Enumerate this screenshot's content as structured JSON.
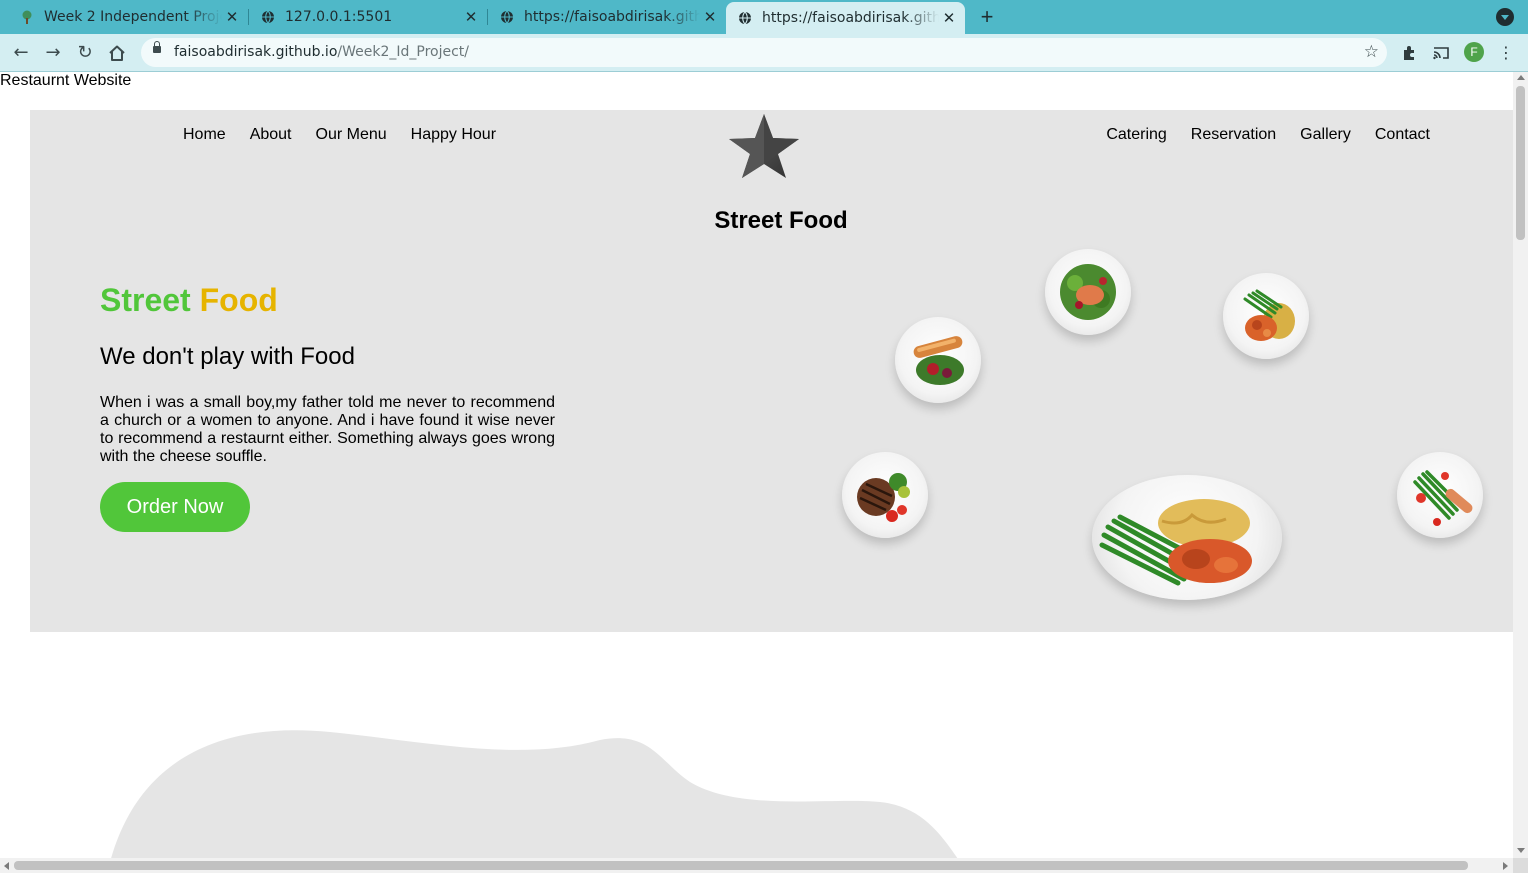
{
  "browser": {
    "tabs": [
      {
        "title": "Week 2 Independent Project",
        "icon": "tree-favicon-icon",
        "active": false
      },
      {
        "title": "127.0.0.1:5501",
        "icon": "globe-icon",
        "active": false
      },
      {
        "title": "https://faisoabdirisak.github.io",
        "icon": "globe-icon",
        "active": false
      },
      {
        "title": "https://faisoabdirisak.github.io",
        "icon": "globe-icon",
        "active": true
      }
    ],
    "new_tab": "+",
    "url_host": "faisoabdirisak.github.io",
    "url_path": "/Week2_Id_Project/",
    "profile_initial": "F",
    "colors": {
      "tabbar": "#4fb8c8",
      "toolbar": "#d4eef2"
    }
  },
  "page": {
    "doc_title": "Restaurnt Website",
    "nav_left": [
      "Home",
      "About",
      "Our Menu",
      "Happy Hour"
    ],
    "nav_right": [
      "Catering",
      "Reservation",
      "Gallery",
      "Contact"
    ],
    "brand": "Street Food",
    "headline": {
      "word1": "Street",
      "word2": "Food"
    },
    "tagline": "We don't play with Food",
    "description": "When i was a small boy,my father told me never to recommend a church or a women to anyone. And i have found it wise never to recommend a restaurnt either. Something always goes wrong with the cheese souffle.",
    "order_button": "Order Now",
    "colors": {
      "hero_bg": "#e5e5e5",
      "green": "#51c63a",
      "yellow": "#e6b400"
    }
  }
}
